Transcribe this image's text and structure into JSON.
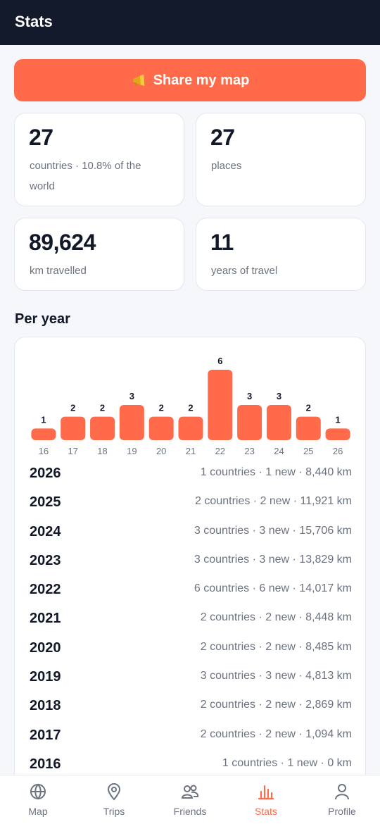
{
  "header": {
    "title": "Stats"
  },
  "share": {
    "label": "Share my map",
    "icon": "megaphone-icon"
  },
  "stats": [
    {
      "value": "27",
      "label": "countries · 10.8% of the world"
    },
    {
      "value": "27",
      "label": "places"
    },
    {
      "value": "89,624",
      "label": "km travelled"
    },
    {
      "value": "11",
      "label": "years of travel"
    }
  ],
  "per_year": {
    "title": "Per year",
    "rows": [
      {
        "year": "2026",
        "info": "1 countries · 1 new · 8,440 km"
      },
      {
        "year": "2025",
        "info": "2 countries · 2 new · 11,921 km"
      },
      {
        "year": "2024",
        "info": "3 countries · 3 new · 15,706 km"
      },
      {
        "year": "2023",
        "info": "3 countries · 3 new · 13,829 km"
      },
      {
        "year": "2022",
        "info": "6 countries · 6 new · 14,017 km"
      },
      {
        "year": "2021",
        "info": "2 countries · 2 new · 8,448 km"
      },
      {
        "year": "2020",
        "info": "2 countries · 2 new · 8,485 km"
      },
      {
        "year": "2019",
        "info": "3 countries · 3 new · 4,813 km"
      },
      {
        "year": "2018",
        "info": "2 countries · 2 new · 2,869 km"
      },
      {
        "year": "2017",
        "info": "2 countries · 2 new · 1,094 km"
      },
      {
        "year": "2016",
        "info": "1 countries · 1 new · 0 km"
      }
    ]
  },
  "chart_data": {
    "type": "bar",
    "categories": [
      "16",
      "17",
      "18",
      "19",
      "20",
      "21",
      "22",
      "23",
      "24",
      "25",
      "26"
    ],
    "values": [
      1,
      2,
      2,
      3,
      2,
      2,
      6,
      3,
      3,
      2,
      1
    ],
    "ylim": [
      0,
      6
    ],
    "grid": false,
    "bar_color": "#ff6b4a"
  },
  "nav": {
    "items": [
      {
        "label": "Map",
        "icon": "globe-icon",
        "active": false
      },
      {
        "label": "Trips",
        "icon": "map-pin-icon",
        "active": false
      },
      {
        "label": "Friends",
        "icon": "friends-icon",
        "active": false
      },
      {
        "label": "Stats",
        "icon": "bar-chart-icon",
        "active": true
      },
      {
        "label": "Profile",
        "icon": "profile-icon",
        "active": false
      }
    ]
  },
  "colors": {
    "accent": "#ff6b4a",
    "header_bg": "#121a2b",
    "text_muted": "#6b7280"
  }
}
